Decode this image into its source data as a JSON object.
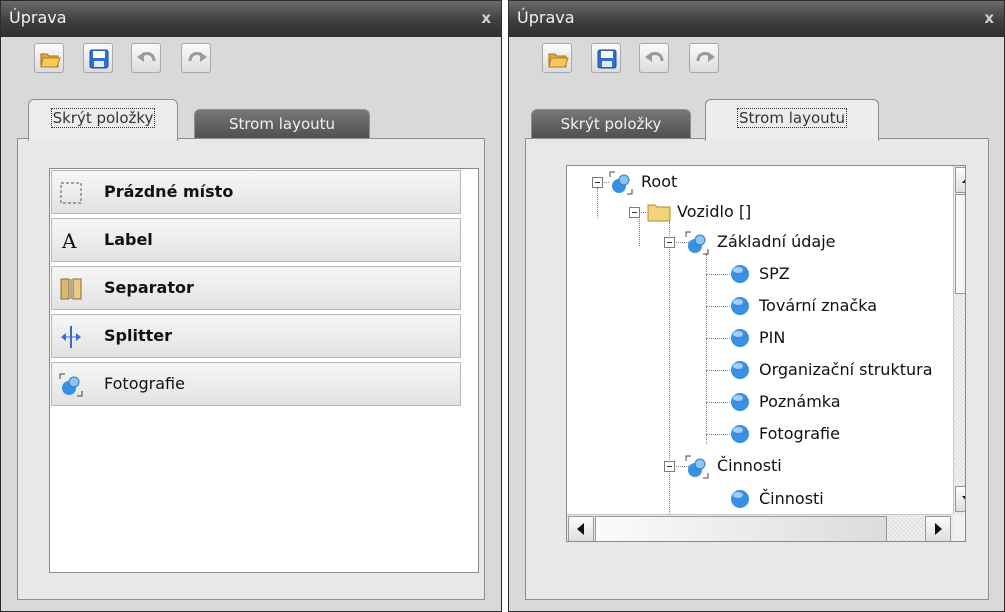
{
  "left_panel": {
    "title": "Úprava",
    "close": "x",
    "tabs": [
      "Skrýt položky",
      "Strom layoutu"
    ],
    "active_tab": 0,
    "items": [
      {
        "label": "Prázdné místo",
        "icon": "empty-space-icon",
        "bold": true
      },
      {
        "label": "Label",
        "icon": "label-icon",
        "bold": true
      },
      {
        "label": "Separator",
        "icon": "separator-icon",
        "bold": true
      },
      {
        "label": "Splitter",
        "icon": "splitter-icon",
        "bold": true
      },
      {
        "label": "Fotografie",
        "icon": "photo-group-icon",
        "bold": false
      }
    ]
  },
  "right_panel": {
    "title": "Úprava",
    "close": "x",
    "tabs": [
      "Skrýt položky",
      "Strom layoutu"
    ],
    "active_tab": 1,
    "tree": {
      "root": "Root",
      "vozidlo": "Vozidlo []",
      "zakladni": "Základní údaje",
      "leaves": [
        "SPZ",
        "Tovární značka",
        "PIN",
        "Organizační struktura",
        "Poznámka",
        "Fotografie"
      ],
      "cinnosti": "Činnosti",
      "cinnosti_child": "Činnosti"
    }
  },
  "toolbar": {
    "icons": [
      "open-folder-icon",
      "save-icon",
      "undo-icon",
      "redo-icon"
    ]
  },
  "colors": {
    "title_bar": "#3f3f3f",
    "panel_bg": "#d9d9d9",
    "node_blue": "#3a8fe0",
    "folder": "#f2d27a"
  }
}
